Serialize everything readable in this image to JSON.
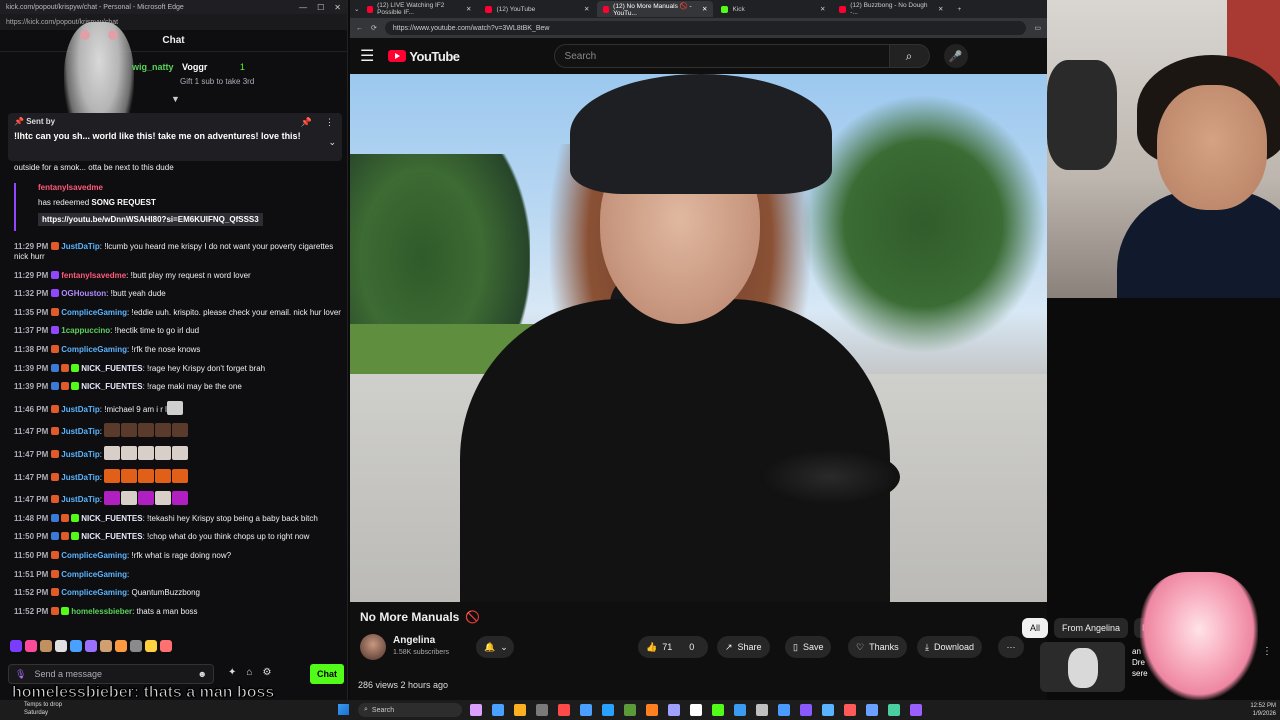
{
  "chat_window": {
    "title": "kick.com/popout/krispyw/chat - Personal - Microsoft Edge",
    "url": "https://kick.com/popout/krispyw/chat",
    "header": "Chat",
    "gift": {
      "gifter": "wig_natty",
      "recipient": "Voggr",
      "count": "1",
      "subtext": "Gift 1 sub to take 3rd"
    },
    "pinned": {
      "sent_by": "Sent by",
      "message": "!lhtc can you sh... world like this! take me on adventures! love this!",
      "continuation": "outside for a smok... otta be next to this dude"
    },
    "redeem": {
      "user": "fentanylsavedme",
      "text_prefix": "has redeemed",
      "reward": "SONG REQUEST",
      "link": "https://youtu.be/wDnnWSAHI80?si=EM6KUIFNQ_QfSSS3"
    },
    "messages": [
      {
        "time": "11:29 PM",
        "user": "JustDaTip",
        "user_color": "#5ab4ff",
        "badges": [
          "#e05a2a"
        ],
        "text": "!lcumb you heard me krispy I do not want your poverty cigarettes nick hurr",
        "emotes": []
      },
      {
        "time": "11:29 PM",
        "user": "fentanylsavedme",
        "user_color": "#ff5a7a",
        "badges": [
          "#9147ff"
        ],
        "text": "!butt play my request n word lover",
        "emotes": []
      },
      {
        "time": "11:32 PM",
        "user": "OGHouston",
        "user_color": "#b18cff",
        "badges": [
          "#9147ff"
        ],
        "text": "!butt yeah dude",
        "emotes": []
      },
      {
        "time": "11:35 PM",
        "user": "CompliceGaming",
        "user_color": "#5ab4ff",
        "badges": [
          "#e05a2a"
        ],
        "text": "!eddie uuh. krispito. please check your email. nick hur lover",
        "emotes": []
      },
      {
        "time": "11:37 PM",
        "user": "1cappuccino",
        "user_color": "#59d259",
        "badges": [
          "#9147ff"
        ],
        "text": "!hectik time to go irl dud",
        "emotes": []
      },
      {
        "time": "11:38 PM",
        "user": "CompliceGaming",
        "user_color": "#5ab4ff",
        "badges": [
          "#e05a2a"
        ],
        "text": "!rfk the nose knows",
        "emotes": []
      },
      {
        "time": "11:39 PM",
        "user": "NICK_FUENTES",
        "user_color": "#e9e9ff",
        "badges": [
          "#3a7bd5",
          "#e05a2a",
          "#53fc18"
        ],
        "text": "!rage hey Krispy don't forget brah",
        "emotes": []
      },
      {
        "time": "11:39 PM",
        "user": "NICK_FUENTES",
        "user_color": "#e9e9ff",
        "badges": [
          "#3a7bd5",
          "#e05a2a",
          "#53fc18"
        ],
        "text": "!rage maki may be the one",
        "emotes": []
      },
      {
        "time": "11:46 PM",
        "user": "JustDaTip",
        "user_color": "#5ab4ff",
        "badges": [
          "#e05a2a"
        ],
        "text": "!michael 9 am i r l",
        "emotes": [
          "#cfcfcf"
        ]
      },
      {
        "time": "11:47 PM",
        "user": "JustDaTip",
        "user_color": "#5ab4ff",
        "badges": [
          "#e05a2a"
        ],
        "text": "",
        "emotes": [
          "#5a3a2a",
          "#5a3a2a",
          "#5a3a2a",
          "#5a3a2a",
          "#5a3a2a"
        ]
      },
      {
        "time": "11:47 PM",
        "user": "JustDaTip",
        "user_color": "#5ab4ff",
        "badges": [
          "#e05a2a"
        ],
        "text": "",
        "emotes": [
          "#d8d0c8",
          "#d8d0c8",
          "#d8d0c8",
          "#d8d0c8",
          "#d8d0c8"
        ]
      },
      {
        "time": "11:47 PM",
        "user": "JustDaTip",
        "user_color": "#5ab4ff",
        "badges": [
          "#e05a2a"
        ],
        "text": "",
        "emotes": [
          "#e0601a",
          "#e0601a",
          "#e0601a",
          "#e0601a",
          "#e0601a"
        ]
      },
      {
        "time": "11:47 PM",
        "user": "JustDaTip",
        "user_color": "#5ab4ff",
        "badges": [
          "#e05a2a"
        ],
        "text": "",
        "emotes": [
          "#b020c0",
          "#d8d0c8",
          "#b020c0",
          "#d8d0c8",
          "#b020c0"
        ]
      },
      {
        "time": "11:48 PM",
        "user": "NICK_FUENTES",
        "user_color": "#e9e9ff",
        "badges": [
          "#3a7bd5",
          "#e05a2a",
          "#53fc18"
        ],
        "text": "!tekashi hey Krispy stop being a baby back bitch",
        "emotes": []
      },
      {
        "time": "11:50 PM",
        "user": "NICK_FUENTES",
        "user_color": "#e9e9ff",
        "badges": [
          "#3a7bd5",
          "#e05a2a",
          "#53fc18"
        ],
        "text": "!chop what do you think chops up to right now",
        "emotes": []
      },
      {
        "time": "11:50 PM",
        "user": "CompliceGaming",
        "user_color": "#5ab4ff",
        "badges": [
          "#e05a2a"
        ],
        "text": "!rfk what is rage doing now?",
        "emotes": []
      },
      {
        "time": "11:51 PM",
        "user": "CompliceGaming",
        "user_color": "#5ab4ff",
        "badges": [
          "#e05a2a"
        ],
        "text": "",
        "emotes": []
      },
      {
        "time": "11:52 PM",
        "user": "CompliceGaming",
        "user_color": "#5ab4ff",
        "badges": [
          "#e05a2a"
        ],
        "text": "QuantumBuzzbong",
        "emotes": []
      },
      {
        "time": "11:52 PM",
        "user": "homelessbieber",
        "user_color": "#59d259",
        "badges": [
          "#e05a2a",
          "#53fc18"
        ],
        "text": "thats a man boss",
        "emotes": []
      }
    ],
    "emote_strip": [
      "#7a3cff",
      "#ff4a9a",
      "#c09060",
      "#e0e0e0",
      "#4aa0ff",
      "#9a70ff",
      "#d0a070",
      "#ff9a40",
      "#8a8a8a",
      "#ffd040",
      "#ff7070"
    ],
    "input_placeholder": "Send a message",
    "send_label": "Chat",
    "overlay_caption": "homelessbieber: thats a man boss"
  },
  "browser": {
    "tabs": [
      {
        "label": "(12) LIVE Watching IF2 Possible IF...",
        "color": "#ff0033",
        "active": false
      },
      {
        "label": "(12) YouTube",
        "color": "#ff0033",
        "active": false
      },
      {
        "label": "(12) No More Manuals 🚫 - YouTu...",
        "color": "#ff0033",
        "active": true
      },
      {
        "label": "Kick",
        "color": "#53fc18",
        "active": false
      },
      {
        "label": "(12) Buzzbong - No Dough -...",
        "color": "#ff0033",
        "active": false
      }
    ],
    "url": "https://www.youtube.com/watch?v=3WL8tBK_Bew"
  },
  "youtube": {
    "logo_text": "YouTube",
    "search_placeholder": "Search",
    "video_title": "No More Manuals",
    "channel_name": "Angelina",
    "subscribers": "1.58K subscribers",
    "likes": "71",
    "dislikes": "0",
    "share_label": "Share",
    "save_label": "Save",
    "thanks_label": "Thanks",
    "download_label": "Download",
    "views_line": "286 views  2 hours ago",
    "chips": [
      "All",
      "From Angelina",
      "R"
    ],
    "related_text": "an\nDre\nsere"
  },
  "taskbar": {
    "weather_line1": "Temps to drop",
    "weather_line2": "Saturday",
    "search_label": "Search",
    "icons": [
      "#d9a0ff",
      "#4aa0ff",
      "#ffb020",
      "#7a7a7a",
      "#ff4a4a",
      "#4aa0ff",
      "#2aa0ff",
      "#5a9a3a",
      "#ff8020",
      "#a0a0ff",
      "#ffffff",
      "#53fc18",
      "#3a9bf0",
      "#c0c0c0",
      "#4a9aff",
      "#8a5aff",
      "#5ab4ff",
      "#ff5a5a",
      "#6aa0ff",
      "#4ad0a0",
      "#9a60ff"
    ],
    "clock_time": "12:52 PM",
    "clock_date": "1/9/2026"
  }
}
